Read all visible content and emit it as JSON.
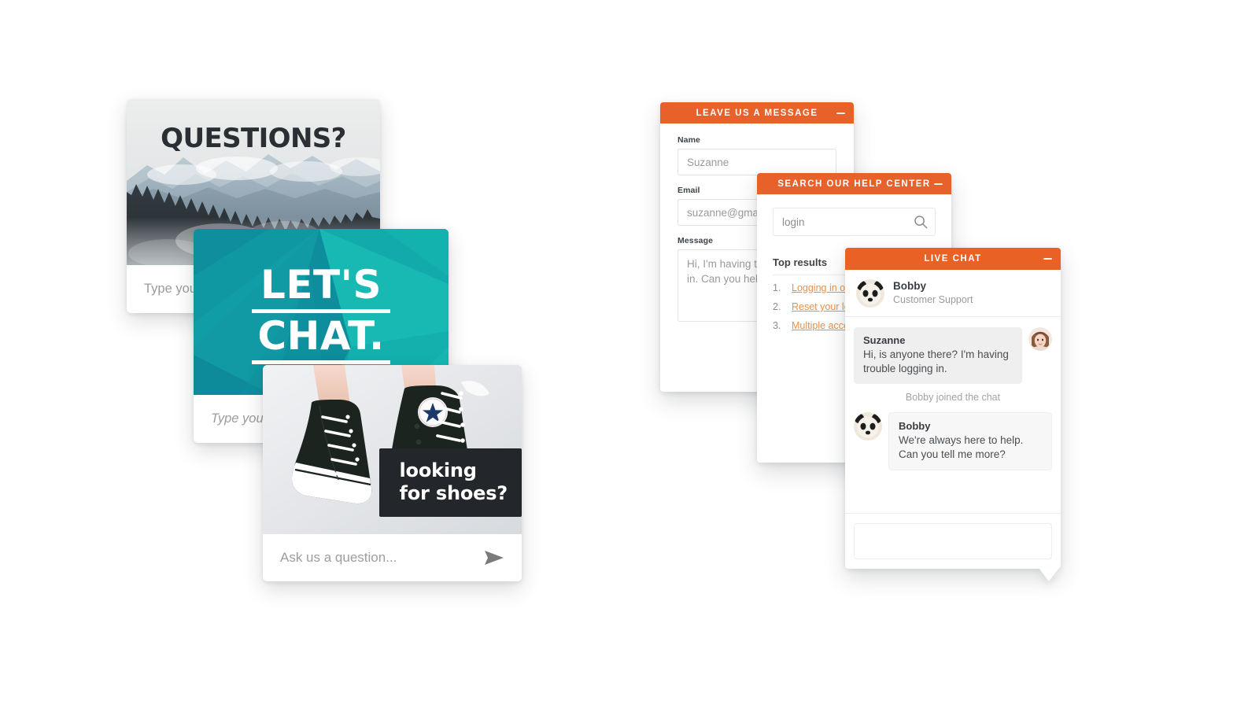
{
  "cards": {
    "questions": {
      "title": "QUESTIONS?",
      "input_placeholder": "Type your message...",
      "image_alt": "mountain-forest-photo"
    },
    "lets_chat": {
      "line1": "LET'S",
      "line2": "CHAT.",
      "input_placeholder": "Type your message...",
      "image_alt": "teal-polygon-graphic"
    },
    "shoes": {
      "banner_line1": "looking",
      "banner_line2": "for shoes?",
      "input_placeholder": "Ask us a question...",
      "send_icon": "send-icon",
      "image_alt": "black-sneakers-photo"
    }
  },
  "widgets": {
    "message": {
      "header_title": "LEAVE US A MESSAGE",
      "minimize_icon": "minimize-icon",
      "fields": [
        {
          "label": "Name",
          "value": "Suzanne"
        },
        {
          "label": "Email",
          "value": "suzanne@gmail.com"
        },
        {
          "label": "Message",
          "value": "Hi, I'm having trouble logging in. Can you help?"
        }
      ]
    },
    "search": {
      "header_title": "SEARCH OUR HELP CENTER",
      "minimize_icon": "minimize-icon",
      "search_icon": "search-icon",
      "search_value": "login",
      "results_heading": "Top results",
      "results": [
        {
          "num": "1.",
          "text": "Logging in or out"
        },
        {
          "num": "2.",
          "text": "Reset your login"
        },
        {
          "num": "3.",
          "text": "Multiple accounts"
        }
      ]
    },
    "chat": {
      "header_title": "LIVE CHAT",
      "minimize_icon": "minimize-icon",
      "agent": {
        "name": "Bobby",
        "role": "Customer Support",
        "avatar": "panda-avatar"
      },
      "messages": [
        {
          "who": "Suzanne",
          "text": "Hi, is anyone there? I'm having trouble logging in.",
          "side": "right",
          "avatar": "woman-avatar"
        },
        {
          "who": "Bobby",
          "text": "We're always here to help. Can you tell me more?",
          "side": "left",
          "avatar": "panda-avatar"
        }
      ],
      "system_line": "Bobby joined the chat",
      "composer_placeholder": ""
    }
  },
  "colors": {
    "brand_orange": "#e8612a",
    "link_orange": "#ef8f44",
    "teal_dark": "#0e7f92",
    "teal_light": "#18bdb0",
    "banner_dark": "#23272b"
  }
}
